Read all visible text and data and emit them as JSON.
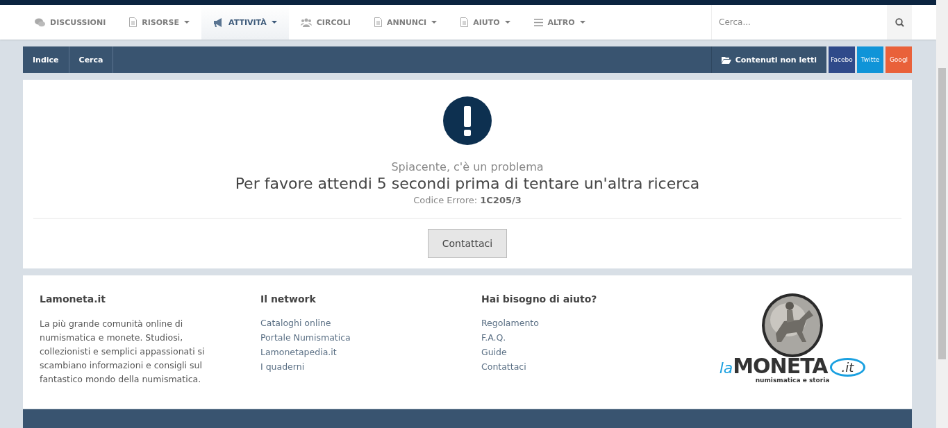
{
  "nav": {
    "items": [
      {
        "label": "DISCUSSIONI",
        "kind": "chat",
        "dropdown": false,
        "selected": false
      },
      {
        "label": "RISORSE",
        "kind": "doc",
        "dropdown": true,
        "selected": false
      },
      {
        "label": "ATTIVITÀ",
        "kind": "megaphone",
        "dropdown": true,
        "selected": true
      },
      {
        "label": "CIRCOLI",
        "kind": "users",
        "dropdown": false,
        "selected": false
      },
      {
        "label": "ANNUNCI",
        "kind": "doc",
        "dropdown": true,
        "selected": false
      },
      {
        "label": "AIUTO",
        "kind": "doc",
        "dropdown": true,
        "selected": false
      },
      {
        "label": "ALTRO",
        "kind": "menu",
        "dropdown": true,
        "selected": false
      }
    ],
    "search": {
      "placeholder": "Cerca..."
    }
  },
  "breadcrumb": {
    "items": [
      "Indice",
      "Cerca"
    ],
    "unread": "Contenuti non letti",
    "social": [
      {
        "label": "Facebo",
        "color": "#2f4a8a"
      },
      {
        "label": "Twitte",
        "color": "#0f94d8"
      },
      {
        "label": "Googl",
        "color": "#e9613a"
      }
    ]
  },
  "error": {
    "subtitle": "Spiacente, c'è un problema",
    "message": "Per favore attendi 5 secondi prima di tentare un'altra ricerca",
    "code": "Codice Errore: **1C205/3**",
    "button": "Contattaci"
  },
  "footer": {
    "about": {
      "title": "Lamoneta.it",
      "text": "La più grande comunità online di numismatica e monete. Studiosi, collezionisti e semplici appassionati si scambiano informazioni e consigli sul fantastico mondo della numismatica."
    },
    "columns": [
      {
        "title": "Il network",
        "links": [
          "Cataloghi online",
          "Portale Numismatica",
          "Lamonetapedia.it",
          "I quaderni"
        ]
      },
      {
        "title": "Hai bisogno di aiuto?",
        "links": [
          "Regolamento",
          "F.A.Q.",
          "Guide",
          "Contattaci"
        ]
      }
    ],
    "logo": {
      "prefix": "la",
      "name": "MONETA",
      "suffix": ".it",
      "tagline": "numismatica e storia"
    }
  }
}
